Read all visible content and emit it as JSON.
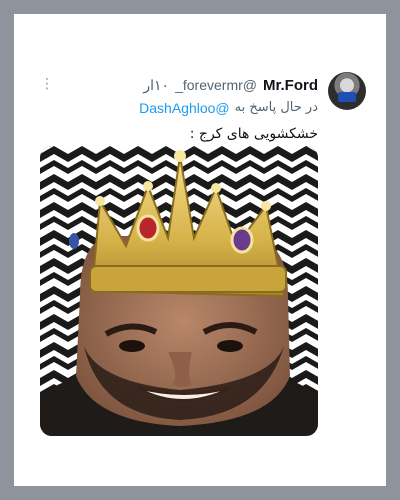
{
  "tweet": {
    "display_name": "Mr.Ford",
    "handle": "@forevermr_",
    "time": "۱۰ار",
    "reply_prefix": "در حال پاسخ به",
    "reply_to": "@DashAghloo",
    "text": "خشکشویی های کرج :"
  },
  "icons": {
    "more": "more-vertical-icon",
    "avatar": "user-avatar"
  },
  "colors": {
    "background": "#8f939c",
    "card": "#ffffff",
    "name": "#0f1419",
    "secondary": "#536471",
    "link": "#1d9bf0",
    "crown": "#d9b646"
  }
}
